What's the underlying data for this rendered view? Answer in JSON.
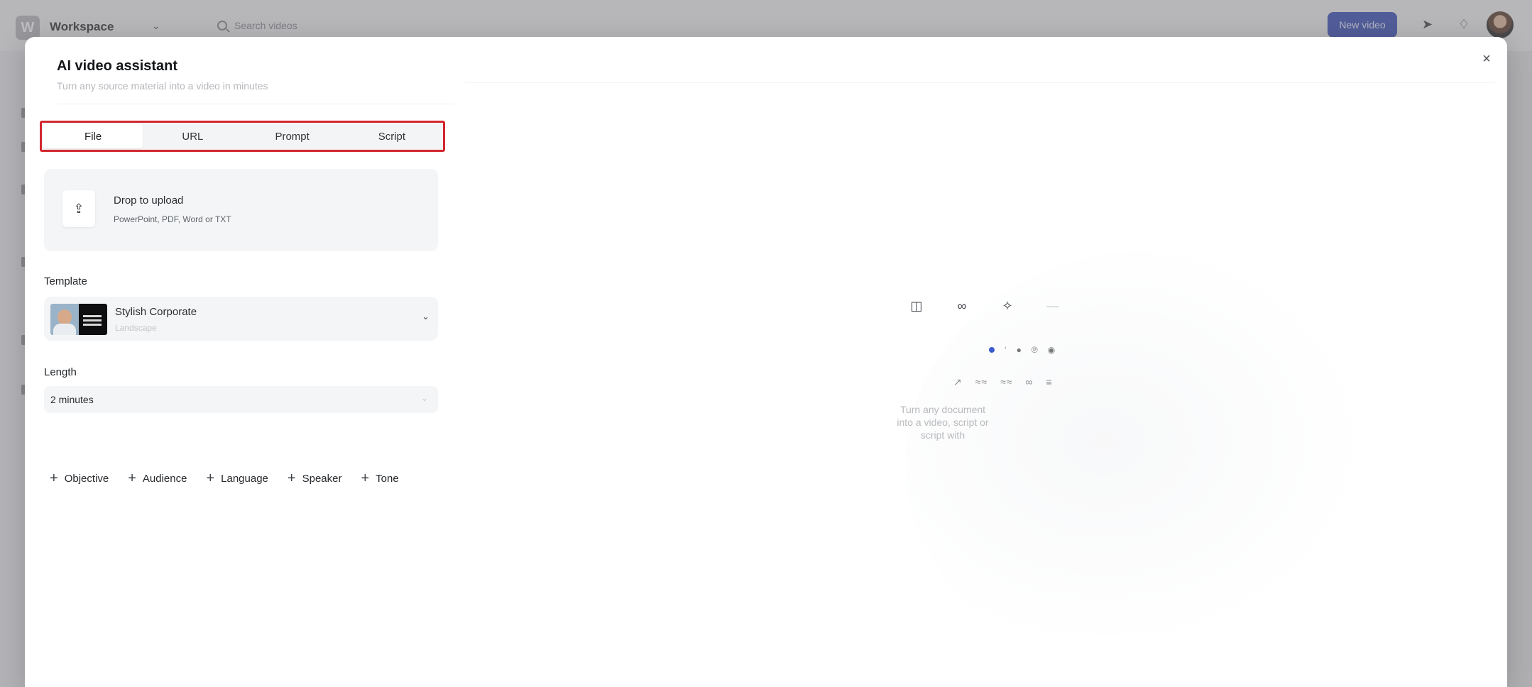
{
  "app": {
    "workspace_initial": "W",
    "workspace_name": "Workspace",
    "search_placeholder": "Search videos",
    "new_video_label": "New video"
  },
  "modal": {
    "title": "AI video assistant",
    "subtitle": "Turn any source material into a video in minutes",
    "close_label": "×"
  },
  "tabs": [
    {
      "label": "File",
      "active": true
    },
    {
      "label": "URL",
      "active": false
    },
    {
      "label": "Prompt",
      "active": false
    },
    {
      "label": "Script",
      "active": false
    }
  ],
  "upload": {
    "icon": "upload-icon",
    "title": "Drop to upload",
    "hint": "PowerPoint, PDF, Word or TXT"
  },
  "template": {
    "label": "Template",
    "name": "Stylish Corporate",
    "orientation": "Landscape"
  },
  "length": {
    "label": "Length",
    "value": "2 minutes"
  },
  "options": [
    {
      "label": "Objective"
    },
    {
      "label": "Audience"
    },
    {
      "label": "Language"
    },
    {
      "label": "Speaker"
    },
    {
      "label": "Tone"
    }
  ],
  "preview": {
    "text": "Turn any document into a video, script or script with"
  },
  "colors": {
    "accent": "#3a4fb8",
    "highlight_border": "#d3272f"
  }
}
